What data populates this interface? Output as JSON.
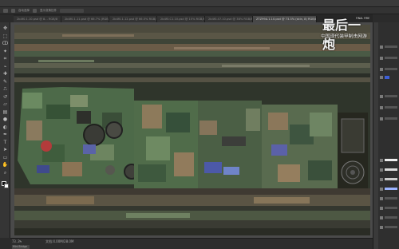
{
  "options_bar": {
    "items": [
      "自动选择",
      "显示变换控件"
    ]
  },
  "tabs": [
    {
      "label": "2b4f0.1.10.psd @ 8... RGB/8"
    },
    {
      "label": "2b4f0.1.11.psd @ 66.7% (RGB/8..."
    },
    {
      "label": "2b4f0.1.12.psd @ 66.5% RGB/8"
    },
    {
      "label": "2b4f0.C1.10.psd @ 15% RGB/8"
    },
    {
      "label": "2b4f0.47.10.psd @ 38% RGB/8"
    },
    {
      "label": "ZTZ99A.1.10.psd @ 73.3% (skin, 8) RGB/8",
      "active": true
    }
  ],
  "tools": [
    {
      "icon": "move-tool-icon",
      "glyph": "✥"
    },
    {
      "icon": "marquee-tool-icon",
      "glyph": "⬚"
    },
    {
      "icon": "lasso-tool-icon",
      "glyph": "ↀ"
    },
    {
      "icon": "magic-wand-icon",
      "glyph": "✦"
    },
    {
      "icon": "crop-tool-icon",
      "glyph": "⌗"
    },
    {
      "icon": "eyedropper-icon",
      "glyph": "⌁"
    },
    {
      "icon": "healing-brush-icon",
      "glyph": "✚"
    },
    {
      "icon": "brush-tool-icon",
      "glyph": "✎"
    },
    {
      "icon": "clone-stamp-icon",
      "glyph": "⎍"
    },
    {
      "icon": "history-brush-icon",
      "glyph": "↺"
    },
    {
      "icon": "eraser-tool-icon",
      "glyph": "▱"
    },
    {
      "icon": "gradient-tool-icon",
      "glyph": "▤"
    },
    {
      "icon": "blur-tool-icon",
      "glyph": "●"
    },
    {
      "icon": "dodge-tool-icon",
      "glyph": "◐"
    },
    {
      "icon": "pen-tool-icon",
      "glyph": "✒"
    },
    {
      "icon": "type-tool-icon",
      "glyph": "T"
    },
    {
      "icon": "path-select-icon",
      "glyph": "➤"
    },
    {
      "icon": "shape-tool-icon",
      "glyph": "▭"
    },
    {
      "icon": "hand-tool-icon",
      "glyph": "✋"
    },
    {
      "icon": "zoom-tool-icon",
      "glyph": "⌕"
    }
  ],
  "status": {
    "zoom": "73.3%",
    "doc_info": "文档:4.00M/28.0M",
    "mini_bridge": "Mini Bridge"
  },
  "watermark": {
    "title": "最后一炮",
    "tag": "FINAL FIRE",
    "subtitle": "中国现代装甲制击网游"
  },
  "colors": {
    "canvas_base": "#3a4032",
    "accent_blue": "#3d5fd6"
  }
}
